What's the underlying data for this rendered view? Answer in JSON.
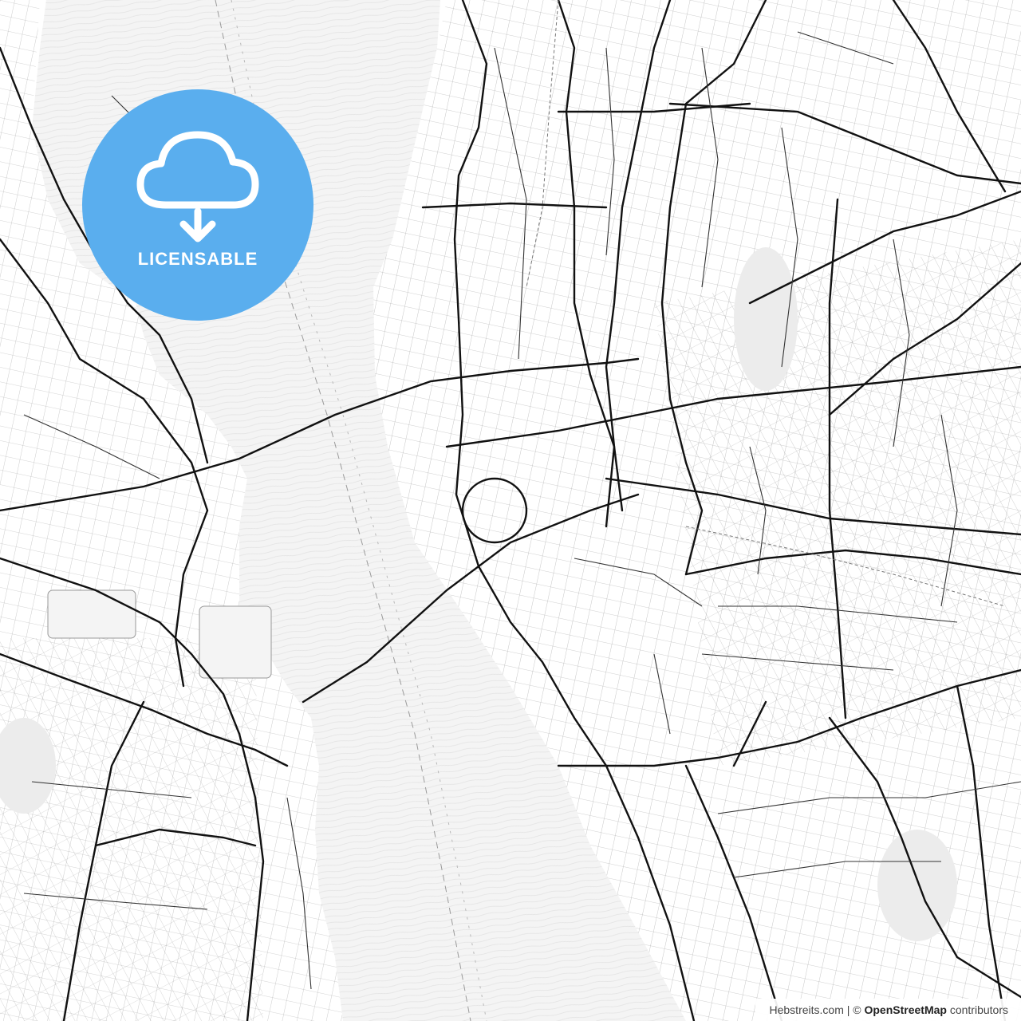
{
  "badge": {
    "label": "LICENSABLE",
    "color": "#5aaeee",
    "icon": "cloud-download-icon"
  },
  "attribution": {
    "site": "Hebstreits.com",
    "separator": " | © ",
    "source": "OpenStreetMap",
    "suffix": " contributors"
  },
  "colors": {
    "background": "#ffffff",
    "water": "#f2f2f2",
    "roads": "#111111",
    "minor_streets": "#555555",
    "parks": "#e8e8e8"
  }
}
